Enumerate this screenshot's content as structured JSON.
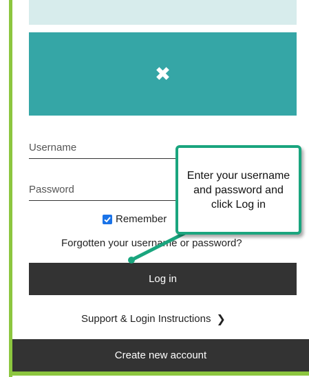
{
  "colors": {
    "accent": "#8cc63f",
    "banner": "#35a6a6",
    "top_strip": "#d7ecec",
    "button": "#333333",
    "callout_border": "#1aa57e",
    "checkbox": "#1a73e8"
  },
  "banner": {
    "icon": "close-icon",
    "close_glyph": "✖"
  },
  "form": {
    "username_placeholder": "Username",
    "password_placeholder": "Password",
    "remember_label": "Remember",
    "remember_checked": true,
    "forgot_link": "Forgotten your username or password?",
    "login_button": "Log in"
  },
  "support": {
    "link": "Support & Login Instructions",
    "icon": "chevron-right-icon",
    "chevron": "❯"
  },
  "create_account_button": "Create new account",
  "callout": {
    "text": "Enter your username and password and click Log in"
  }
}
